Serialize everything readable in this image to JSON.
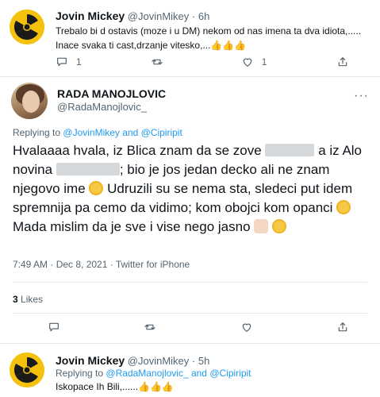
{
  "tweet_top": {
    "name": "Jovin Mickey",
    "handle": "@JovinMikey",
    "time": "· 6h",
    "text_line1": "Trebalo bi d ostavis (moze i u DM) nekom od nas imena ta dva idiota,.....",
    "text_line2": "Inace svaka ti cast,drzanje vitesko,...",
    "thumbs": "👍👍👍",
    "reply_count": "1",
    "retweet_count": "",
    "like_count": "1"
  },
  "tweet_main": {
    "name": "RADA MANOJLOVIC",
    "handle": "@RadaManojlovic_",
    "more": "···",
    "replying_prefix": "Replying to",
    "replying_users": "@JovinMikey and @Cipiripit",
    "text_a": "Hvalaaaa hvala, iz Blica znam da se zove",
    "text_b": "a iz Alo novina",
    "text_c": "; bio je jos jedan decko ali ne znam njegovo ime",
    "text_d": "Udruzili su se nema sta, sledeci put idem spremnija pa cemo da vidimo; kom obojci kom opanci",
    "text_e": "Mada mislim da je sve i vise nego jasno",
    "meta": "7:49 AM · Dec 8, 2021 · Twitter for iPhone",
    "likes_count": "3",
    "likes_label": "Likes"
  },
  "tweet_bottom": {
    "name": "Jovin Mickey",
    "handle": "@JovinMikey",
    "time": "· 5h",
    "replying_prefix": "Replying to",
    "replying_users": "@RadaManojlovic_ and @Cipiripit",
    "text": "Iskopace Ih Bili,......",
    "thumbs": "👍👍👍"
  }
}
